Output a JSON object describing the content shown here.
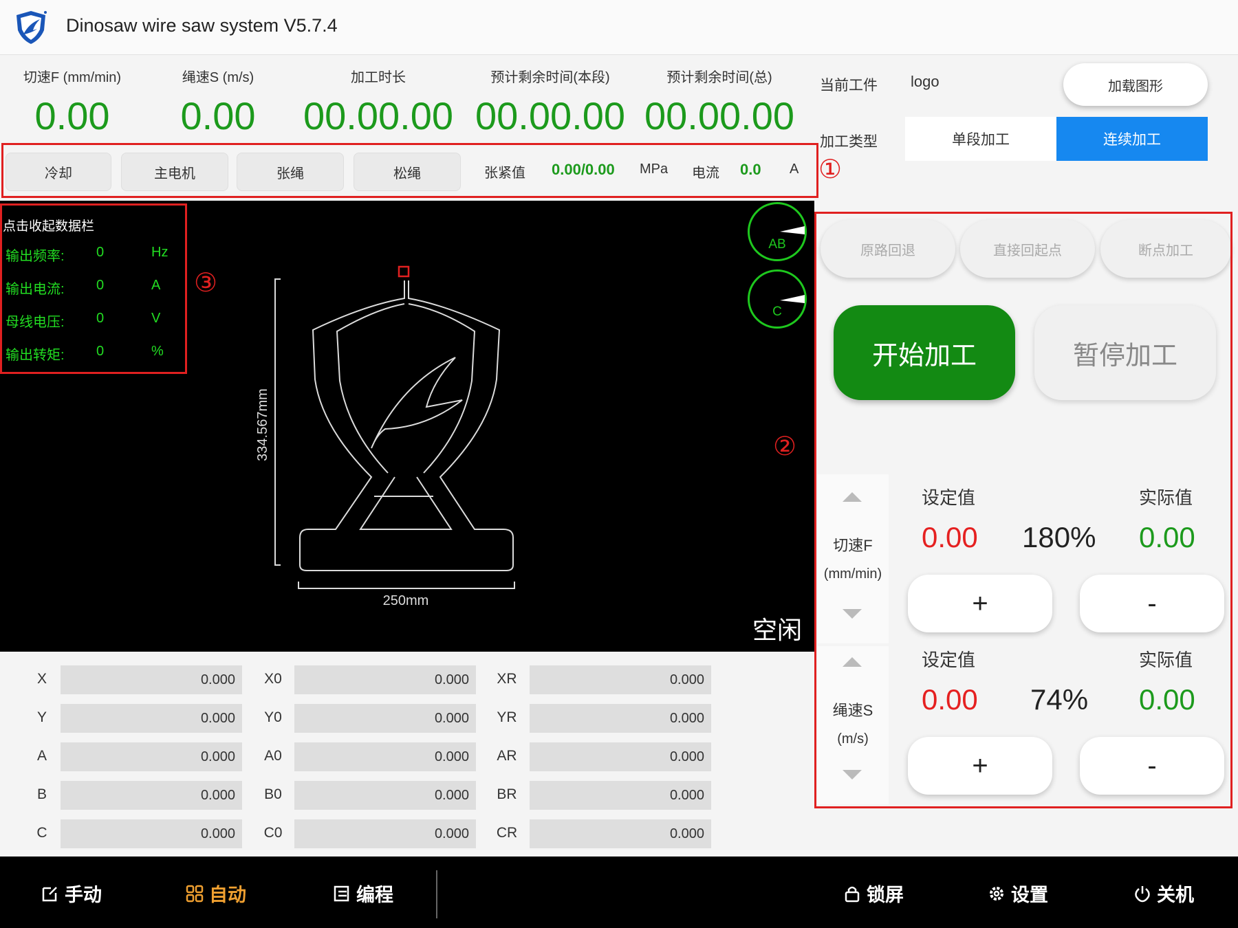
{
  "app": {
    "title": "Dinosaw wire saw system V5.7.4"
  },
  "stats": [
    {
      "label": "切速F (mm/min)",
      "value": "0.00"
    },
    {
      "label": "绳速S (m/s)",
      "value": "0.00"
    },
    {
      "label": "加工时长",
      "value": "00.00.00"
    },
    {
      "label": "预计剩余时间(本段)",
      "value": "00.00.00"
    },
    {
      "label": "预计剩余时间(总)",
      "value": "00.00.00"
    }
  ],
  "controls": {
    "buttons": [
      "冷却",
      "主电机",
      "张绳",
      "松绳"
    ],
    "tension_label": "张紧值",
    "tension_value": "0.00/0.00",
    "tension_unit": "MPa",
    "current_label": "电流",
    "current_value": "0.0",
    "current_unit": "A"
  },
  "annotations": [
    "①",
    "②",
    "③"
  ],
  "data_panel": {
    "title": "点击收起数据栏",
    "rows": [
      {
        "label": "输出频率:",
        "value": "0",
        "unit": "Hz"
      },
      {
        "label": "输出电流:",
        "value": "0",
        "unit": "A"
      },
      {
        "label": "母线电压:",
        "value": "0",
        "unit": "V"
      },
      {
        "label": "输出转矩:",
        "value": "0",
        "unit": "%"
      }
    ]
  },
  "drawing": {
    "height_dim": "334.567mm",
    "width_dim": "250mm"
  },
  "dials": [
    "AB",
    "C"
  ],
  "status": "空闲",
  "coords": [
    [
      {
        "label": "X",
        "value": "0.000"
      },
      {
        "label": "X0",
        "value": "0.000"
      },
      {
        "label": "XR",
        "value": "0.000"
      }
    ],
    [
      {
        "label": "Y",
        "value": "0.000"
      },
      {
        "label": "Y0",
        "value": "0.000"
      },
      {
        "label": "YR",
        "value": "0.000"
      }
    ],
    [
      {
        "label": "A",
        "value": "0.000"
      },
      {
        "label": "A0",
        "value": "0.000"
      },
      {
        "label": "AR",
        "value": "0.000"
      }
    ],
    [
      {
        "label": "B",
        "value": "0.000"
      },
      {
        "label": "B0",
        "value": "0.000"
      },
      {
        "label": "BR",
        "value": "0.000"
      }
    ],
    [
      {
        "label": "C",
        "value": "0.000"
      },
      {
        "label": "C0",
        "value": "0.000"
      },
      {
        "label": "CR",
        "value": "0.000"
      }
    ]
  ],
  "nav": {
    "left": [
      {
        "label": "手动",
        "icon": "edit-icon"
      },
      {
        "label": "自动",
        "icon": "grid-icon",
        "active": true
      },
      {
        "label": "编程",
        "icon": "program-icon"
      }
    ],
    "right": [
      {
        "label": "锁屏",
        "icon": "lock-icon"
      },
      {
        "label": "设置",
        "icon": "gear-icon"
      },
      {
        "label": "关机",
        "icon": "power-icon"
      }
    ]
  },
  "workpiece": {
    "label": "当前工件",
    "name": "logo",
    "load_button": "加载图形",
    "type_label": "加工类型",
    "type_options": [
      "单段加工",
      "连续加工"
    ],
    "type_selected": 1
  },
  "actions": {
    "pills": [
      "原路回退",
      "直接回起点",
      "断点加工"
    ],
    "start": "开始加工",
    "pause": "暂停加工"
  },
  "params": [
    {
      "name": "切速F",
      "unit": "(mm/min)",
      "set_label": "设定值",
      "actual_label": "实际值",
      "set": "0.00",
      "percent": "180%",
      "actual": "0.00",
      "plus": "+",
      "minus": "-"
    },
    {
      "name": "绳速S",
      "unit": "(m/s)",
      "set_label": "设定值",
      "actual_label": "实际值",
      "set": "0.00",
      "percent": "74%",
      "actual": "0.00",
      "plus": "+",
      "minus": "-"
    }
  ],
  "colors": {
    "green_value": "#1c9a1c",
    "start_button": "#138a13",
    "selected_type": "#1688f0",
    "set_value_red": "#e52020",
    "annotation_red": "#e02020",
    "nav_active": "#f0a030"
  }
}
